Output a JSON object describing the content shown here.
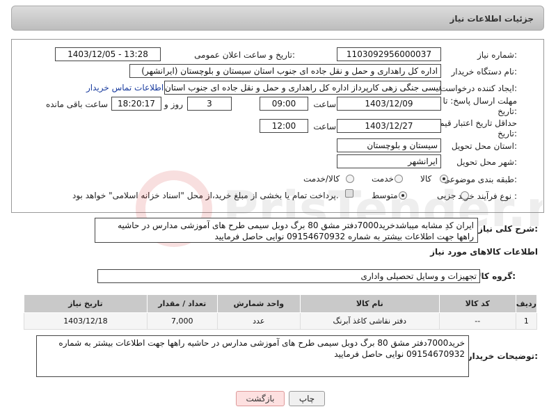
{
  "header": {
    "title": "جزئیات اطلاعات نیاز"
  },
  "form": {
    "need_number_label": "شماره نیاز:",
    "need_number": "1103092956000037",
    "announce_label": "تاریخ و ساعت اعلان عمومی:",
    "announce_value": "1403/12/05 - 13:28",
    "buyer_org_label": "نام دستگاه خریدار:",
    "buyer_org": "اداره کل راهداری و حمل و نقل جاده ای جنوب استان سیستان و بلوچستان (ایرانشهر)",
    "creator_label": "ایجاد کننده درخواست:",
    "creator": "عیسی جنگی زهی کارپرداز اداره کل راهداری و حمل و نقل جاده ای جنوب استان",
    "contact_link": "اطلاعات تماس خریدار",
    "deadline_label_1": "مهلت ارسال پاسخ: تا",
    "deadline_label_2": "تاریخ:",
    "deadline_date": "1403/12/09",
    "time_label": "ساعت",
    "deadline_time": "09:00",
    "days_value": "3",
    "days_label": "روز و",
    "remaining_time": "18:20:17",
    "remaining_label": "ساعت باقی مانده",
    "price_validity_label_1": "حداقل تاریخ اعتبار قیمت: تا",
    "price_validity_label_2": "تاریخ:",
    "price_validity_date": "1403/12/27",
    "price_validity_time": "12:00",
    "province_label": "استان محل تحویل:",
    "province": "سیستان و بلوچستان",
    "city_label": "شهر محل تحویل:",
    "city": "ایرانشهر",
    "category_label": "طبقه بندی موضوعی:",
    "category_options": [
      "کالا",
      "خدمت",
      "کالا/خدمت"
    ],
    "process_label": "نوع فرآیند خرید :",
    "process_options": [
      "جزیی",
      "متوسط"
    ],
    "treasury_note": "پرداخت تمام یا بخشی از مبلغ خرید،از محل \"اسناد خزانه اسلامی\" خواهد بود."
  },
  "summary": {
    "label": "شرح کلی نیاز:",
    "text": "ایران کدِ مشابه میباشدخرید7000دفتر مشق 80 برگ دوبل سیمی طرح های آموزشی مدارس در حاشیه راهها جهت اطلاعات بیشتر به شماره 09154670932 نوایی حاصل فرمایید"
  },
  "goods": {
    "section_title": "اطلاعات کالاهای مورد نیاز",
    "group_label": "گروه کالا:",
    "group_value": "تجهیزات و وسایل تحصیلی واداری",
    "columns": [
      "ردیف",
      "کد کالا",
      "نام کالا",
      "واحد شمارش",
      "تعداد / مقدار",
      "تاریخ نیاز"
    ],
    "rows": [
      [
        "1",
        "--",
        "دفتر نقاشی کاغذ آبرنگ",
        "عدد",
        "7,000",
        "1403/12/18"
      ]
    ]
  },
  "buyer_notes": {
    "label": "توضیحات خریدار:",
    "text": "خرید7000دفتر مشق 80 برگ دوبل سیمی طرح های آموزشی مدارس در حاشیه راهها جهت اطلاعات بیشتر به شماره 09154670932 نوایی حاصل فرمایید"
  },
  "buttons": {
    "print": "چاپ",
    "back": "بازگشت"
  },
  "watermark": {
    "text": "PrisTender.net"
  }
}
